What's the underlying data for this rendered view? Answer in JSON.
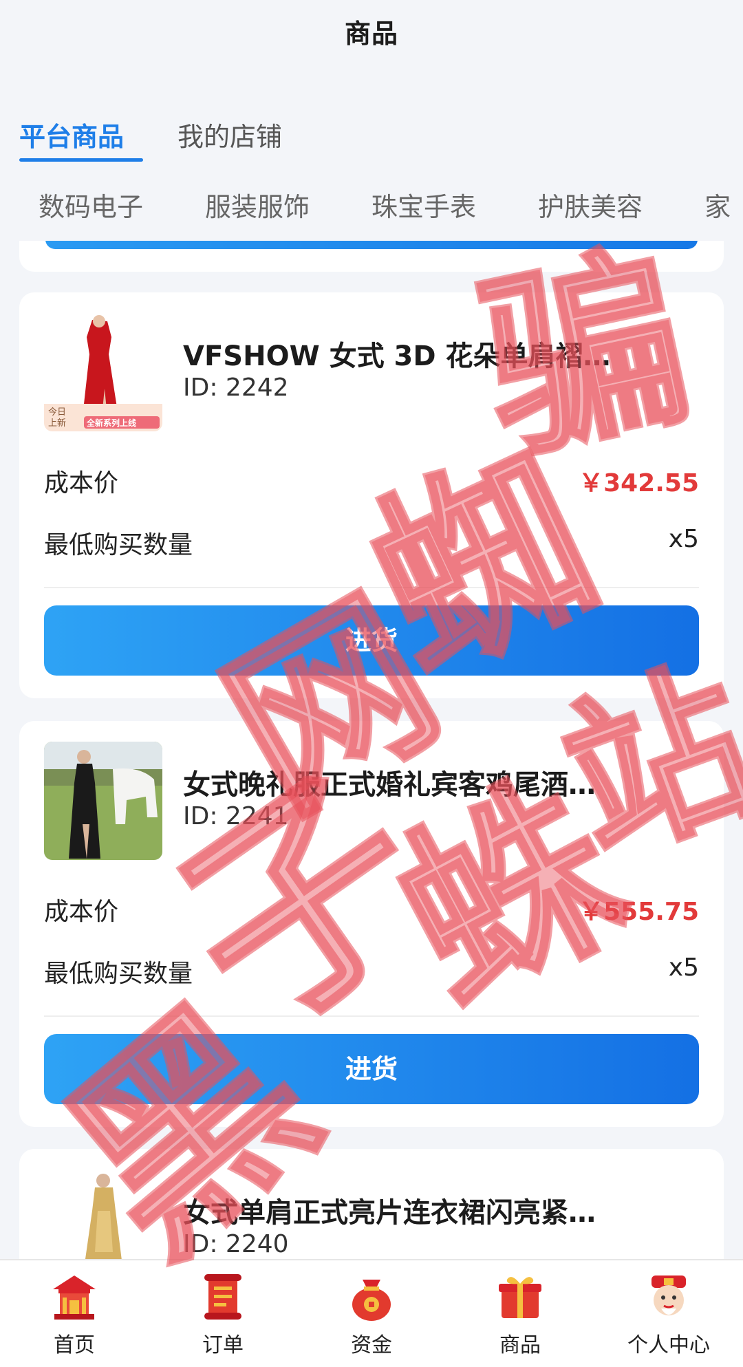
{
  "header": {
    "title": "商品"
  },
  "main_tabs": [
    {
      "label": "平台商品",
      "active": true
    },
    {
      "label": "我的店铺",
      "active": false
    }
  ],
  "category_tabs": [
    "数码电子",
    "服装服饰",
    "珠宝手表",
    "护肤美容",
    "家"
  ],
  "products": [
    {
      "title": "VFSHOW 女式 3D 花朵单肩褶…",
      "id_text": "ID: 2242",
      "cost_label": "成本价",
      "cost_value": "￥342.55",
      "min_label": "最低购买数量",
      "min_value": "x5",
      "button_label": "进货",
      "badge_line1": "今日",
      "badge_line2": "上新",
      "badge_banner": "全新系列上线"
    },
    {
      "title": "女式晚礼服正式婚礼宾客鸡尾酒…",
      "id_text": "ID: 2241",
      "cost_label": "成本价",
      "cost_value": "￥555.75",
      "min_label": "最低购买数量",
      "min_value": "x5",
      "button_label": "进货"
    },
    {
      "title": "女式单肩正式亮片连衣裙闪亮紧…",
      "id_text": "ID: 2240"
    }
  ],
  "bottom_nav": [
    {
      "label": "首页",
      "icon": "temple-icon"
    },
    {
      "label": "订单",
      "icon": "scroll-icon"
    },
    {
      "label": "资金",
      "icon": "money-bag-icon"
    },
    {
      "label": "商品",
      "icon": "gift-box-icon"
    },
    {
      "label": "个人中心",
      "icon": "fortune-god-icon"
    }
  ],
  "watermark": {
    "chars": [
      "骗",
      "子",
      "蜘",
      "蛛",
      "网",
      "站",
      "黑"
    ]
  },
  "colors": {
    "accent": "#1e7ee8",
    "price": "#e23a3a",
    "button_start": "#2ea3f5",
    "button_end": "#1470e4",
    "watermark": "#e8505a"
  }
}
